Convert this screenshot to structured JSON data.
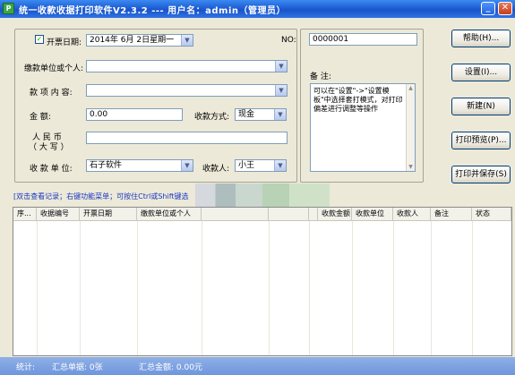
{
  "window": {
    "title": "统一收款收据打印软件V2.3.2 --- 用户名：admin（管理员）",
    "app_icon_letter": "P"
  },
  "form": {
    "invoice_date_label": "开票日期:",
    "invoice_date_checked": true,
    "invoice_date_value": "2014年 6月 2日星期一",
    "no_label": "NO:",
    "no_value": "0000001",
    "payer_label": "缴款单位或个人:",
    "payer_value": "",
    "item_label": "款 项 内 容:",
    "item_value": "",
    "amount_label": "金        额:",
    "amount_value": "0.00",
    "payment_method_label": "收款方式:",
    "payment_method_value": "现金",
    "rmb_label_line1": "人    民    币",
    "rmb_label_line2": "（ 大    写 ）",
    "rmb_value": "",
    "payee_unit_label": "收 款 单 位:",
    "payee_unit_value": "石子软件",
    "payee_label": "收款人:",
    "payee_value": "小王",
    "notes_label": "备 注:",
    "notes_value": "可以在\"设置\"->\"设置模板\"中选择套打模式，对打印偏差进行调整等操作"
  },
  "buttons": {
    "help": "帮助(H)...",
    "settings": "设置(I)...",
    "new": "新建(N)",
    "print_preview": "打印预览(P)...",
    "print_save": "打印并保存(S)"
  },
  "hint": "[双击查看记录；右键功能菜单；可按住Ctrl或Shift键选",
  "grid": {
    "columns": [
      "序...",
      "收据编号",
      "开票日期",
      "缴款单位或个人",
      "",
      "",
      "",
      "收款金额",
      "收款单位",
      "收款人",
      "备注",
      "状态"
    ],
    "rows": []
  },
  "status": {
    "label": "统计:",
    "count_text": "汇总单据: 0张",
    "total_text": "汇总金额: 0.00元"
  },
  "colors": {
    "title_bar": "#1f5fd6",
    "status_bar": "#7a9fe0",
    "hint_text": "#1a37c4"
  }
}
